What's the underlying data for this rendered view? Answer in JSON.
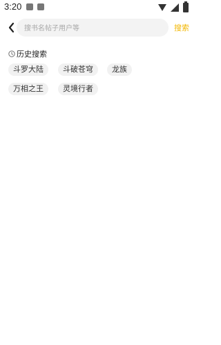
{
  "status_bar": {
    "time": "3:20"
  },
  "search": {
    "placeholder": "搜书名帖子用户等",
    "value": "",
    "button_label": "搜索"
  },
  "history": {
    "title": "历史搜索",
    "tags": [
      "斗罗大陆",
      "斗破苍穹",
      "龙族",
      "万相之王",
      "灵境行者"
    ]
  },
  "colors": {
    "accent": "#f2b705",
    "search_bg": "#f3f3f3",
    "tag_bg": "#f1f1f1"
  },
  "icons": {
    "back": "chevron-left-icon",
    "history": "clock-icon"
  }
}
